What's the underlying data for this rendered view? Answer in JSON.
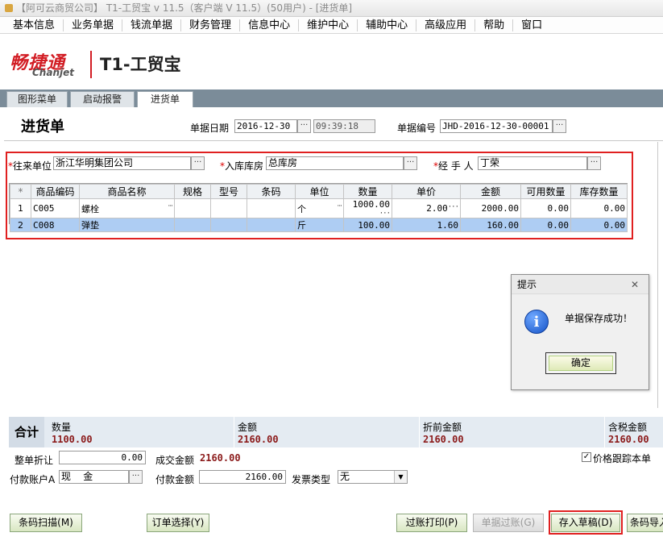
{
  "window": {
    "title": "【阿可云商贸公司】 T1-工贸宝 v 11.5（客户端 V 11.5）(50用户) - [进货单]"
  },
  "menu": [
    "基本信息",
    "业务单据",
    "钱流单据",
    "财务管理",
    "信息中心",
    "维护中心",
    "辅助中心",
    "高级应用",
    "帮助",
    "窗口"
  ],
  "logo": {
    "cn": "畅捷通",
    "en": "Chanjet",
    "product": "T1-工贸宝"
  },
  "tabs": [
    "图形菜单",
    "启动报警",
    "进货单"
  ],
  "form": {
    "title": "进货单",
    "date_label": "单据日期",
    "date": "2016-12-30",
    "time": "09:39:18",
    "number_label": "单据编号",
    "number": "JHD-2016-12-30-00001",
    "partner_label": "往来单位",
    "partner": "浙江华明集团公司",
    "warehouse_label": "入库库房",
    "warehouse": "总库房",
    "handler_label": "经 手 人",
    "handler": "丁荣",
    "required_mark": "*"
  },
  "grid": {
    "header_marker": "*",
    "columns": [
      "商品编码",
      "商品名称",
      "规格",
      "型号",
      "条码",
      "单位",
      "数量",
      "单价",
      "金额",
      "可用数量",
      "库存数量"
    ],
    "rows": [
      {
        "idx": "1",
        "code": "C005",
        "name": "螺栓",
        "spec": "",
        "model": "",
        "barcode": "",
        "unit": "个",
        "qty": "1000.00",
        "price": "2.00",
        "amount": "2000.00",
        "avail": "0.00",
        "stock": "0.00"
      },
      {
        "idx": "2",
        "code": "C008",
        "name": "弹垫",
        "spec": "",
        "model": "",
        "barcode": "",
        "unit": "斤",
        "qty": "100.00",
        "price": "1.60",
        "amount": "160.00",
        "avail": "0.00",
        "stock": "0.00"
      }
    ]
  },
  "dialog": {
    "title": "提示",
    "message": "单据保存成功！",
    "ok": "确定",
    "close": "✕"
  },
  "totals": {
    "label": "合计",
    "qty_label": "数量",
    "qty": "1100.00",
    "amount_label": "金额",
    "amount": "2160.00",
    "pre_discount_label": "折前金额",
    "pre_discount": "2160.00",
    "tax_amount_label": "含税金额",
    "tax_amount": "2160.00"
  },
  "footer": {
    "discount_label": "整单折让",
    "discount": "0.00",
    "deal_label": "成交金额",
    "deal": "2160.00",
    "price_track_label": "价格跟踪本单",
    "account_label": "付款账户A",
    "account": "现    金",
    "payment_label": "付款金额",
    "payment": "2160.00",
    "invoice_label": "发票类型",
    "invoice": "无"
  },
  "buttons": {
    "scan": "条码扫描(M)",
    "order_select": "订单选择(Y)",
    "post_print": "过账打印(P)",
    "post": "单据过账(G)",
    "save_draft": "存入草稿(D)",
    "barcode_import": "条码导入"
  },
  "colors": {
    "highlight_red": "#e02020",
    "total_value": "#8b1a1a",
    "tab_bar": "#7b8c99",
    "selected_row": "#aecdf3"
  }
}
